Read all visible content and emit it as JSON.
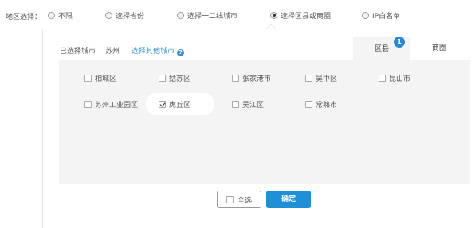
{
  "region": {
    "label": "地区选择：",
    "options": [
      {
        "label": "不限",
        "selected": false
      },
      {
        "label": "选择省份",
        "selected": false
      },
      {
        "label": "选择一二线城市",
        "selected": false
      },
      {
        "label": "选择区县或商圈",
        "selected": true
      },
      {
        "label": "IP白名单",
        "selected": false
      }
    ]
  },
  "selection": {
    "selected_label": "已选择城市",
    "city": "苏州",
    "other_link": "选择其他城市",
    "help_icon": "question-circle-icon"
  },
  "tabs": [
    {
      "label": "区县",
      "active": true,
      "badge": "1"
    },
    {
      "label": "商圈",
      "active": false
    }
  ],
  "districts": [
    {
      "label": "相城区",
      "checked": false
    },
    {
      "label": "姑苏区",
      "checked": false
    },
    {
      "label": "张家港市",
      "checked": false
    },
    {
      "label": "吴中区",
      "checked": false
    },
    {
      "label": "昆山市",
      "checked": false
    },
    {
      "label": "苏州工业园区",
      "checked": false
    },
    {
      "label": "虎丘区",
      "checked": true
    },
    {
      "label": "吴江区",
      "checked": false
    },
    {
      "label": "常熟市",
      "checked": false
    }
  ],
  "footer": {
    "select_all_label": "全选",
    "confirm_label": "确定"
  },
  "colors": {
    "accent": "#1f8fd8",
    "link": "#3b8fd4",
    "panel_bg": "#f4f4f4"
  }
}
